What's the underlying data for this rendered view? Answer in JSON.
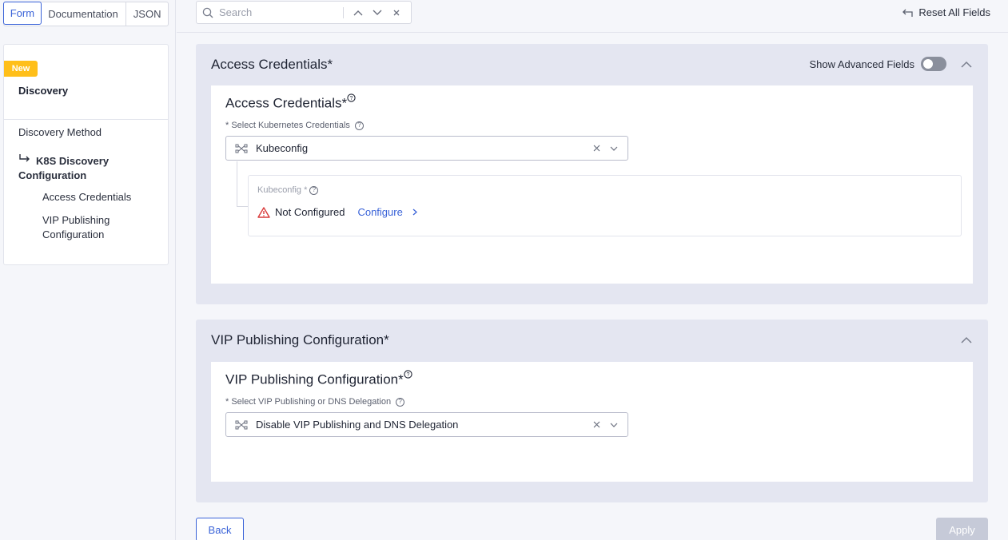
{
  "tabs": [
    {
      "label": "Form",
      "active": true
    },
    {
      "label": "Documentation",
      "active": false
    },
    {
      "label": "JSON",
      "active": false
    }
  ],
  "nav": {
    "badge": "New",
    "heading": "Discovery",
    "items": [
      {
        "label": "Discovery Method"
      },
      {
        "label": "K8S Discovery Configuration"
      },
      {
        "label": "Access Credentials"
      },
      {
        "label": "VIP Publishing Configuration"
      }
    ]
  },
  "search": {
    "placeholder": "Search",
    "value": ""
  },
  "reset_label": "Reset All Fields",
  "sections": [
    {
      "title": "Access Credentials*",
      "advanced_label": "Show Advanced Fields",
      "advanced_on": false,
      "panel_title": "Access Credentials*",
      "field_label": "* Select Kubernetes Credentials",
      "select_value": "Kubeconfig",
      "sub": {
        "label": "Kubeconfig *",
        "status": "Not Configured",
        "action": "Configure"
      }
    },
    {
      "title": "VIP Publishing Configuration*",
      "panel_title": "VIP Publishing Configuration*",
      "field_label": "* Select VIP Publishing or DNS Delegation",
      "select_value": "Disable VIP Publishing and DNS Delegation"
    }
  ],
  "buttons": {
    "back": "Back",
    "apply": "Apply"
  },
  "colors": {
    "accent": "#3a63d8",
    "badge": "#ffbf1a",
    "warning": "#d93a3a",
    "section_bg": "#e4e6f1"
  }
}
